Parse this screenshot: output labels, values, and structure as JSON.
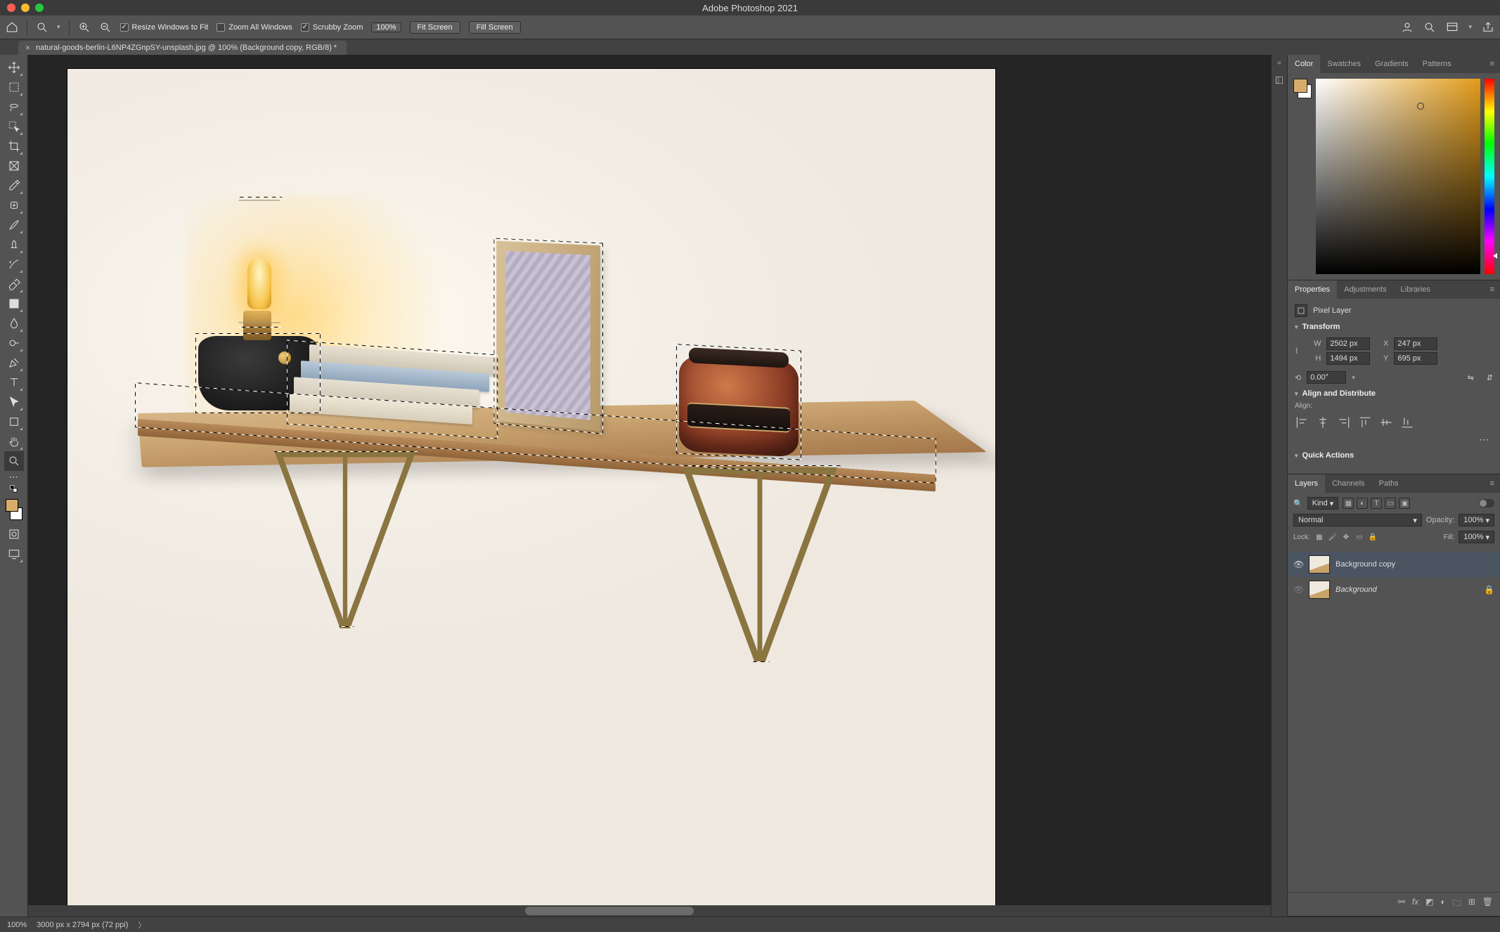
{
  "app_title": "Adobe Photoshop 2021",
  "options": {
    "resize_windows": "Resize Windows to Fit",
    "zoom_all": "Zoom All Windows",
    "scrubby": "Scrubby Zoom",
    "zoom_pct": "100%",
    "fit_screen": "Fit Screen",
    "fill_screen": "Fill Screen"
  },
  "doc_tab": "natural-goods-berlin-L6NP4ZGnpSY-unsplash.jpg @ 100% (Background copy, RGB/8) *",
  "panels": {
    "color": {
      "tabs": [
        "Color",
        "Swatches",
        "Gradients",
        "Patterns"
      ]
    },
    "properties": {
      "tabs": [
        "Properties",
        "Adjustments",
        "Libraries"
      ],
      "type_label": "Pixel Layer",
      "transform_head": "Transform",
      "W": "2502 px",
      "X": "247 px",
      "H": "1494 px",
      "Y": "695 px",
      "angle": "0.00°",
      "align_head": "Align and Distribute",
      "align_label": "Align:",
      "quick_head": "Quick Actions"
    },
    "layers": {
      "tabs": [
        "Layers",
        "Channels",
        "Paths"
      ],
      "kind": "Kind",
      "blend": "Normal",
      "opacity_label": "Opacity:",
      "opacity": "100%",
      "lock_label": "Lock:",
      "fill_label": "Fill:",
      "fill": "100%",
      "items": [
        {
          "name": "Background copy",
          "selected": true,
          "locked": false
        },
        {
          "name": "Background",
          "selected": false,
          "locked": true
        }
      ]
    }
  },
  "status": {
    "zoom": "100%",
    "doc_dims": "3000 px x 2794 px (72 ppi)"
  }
}
